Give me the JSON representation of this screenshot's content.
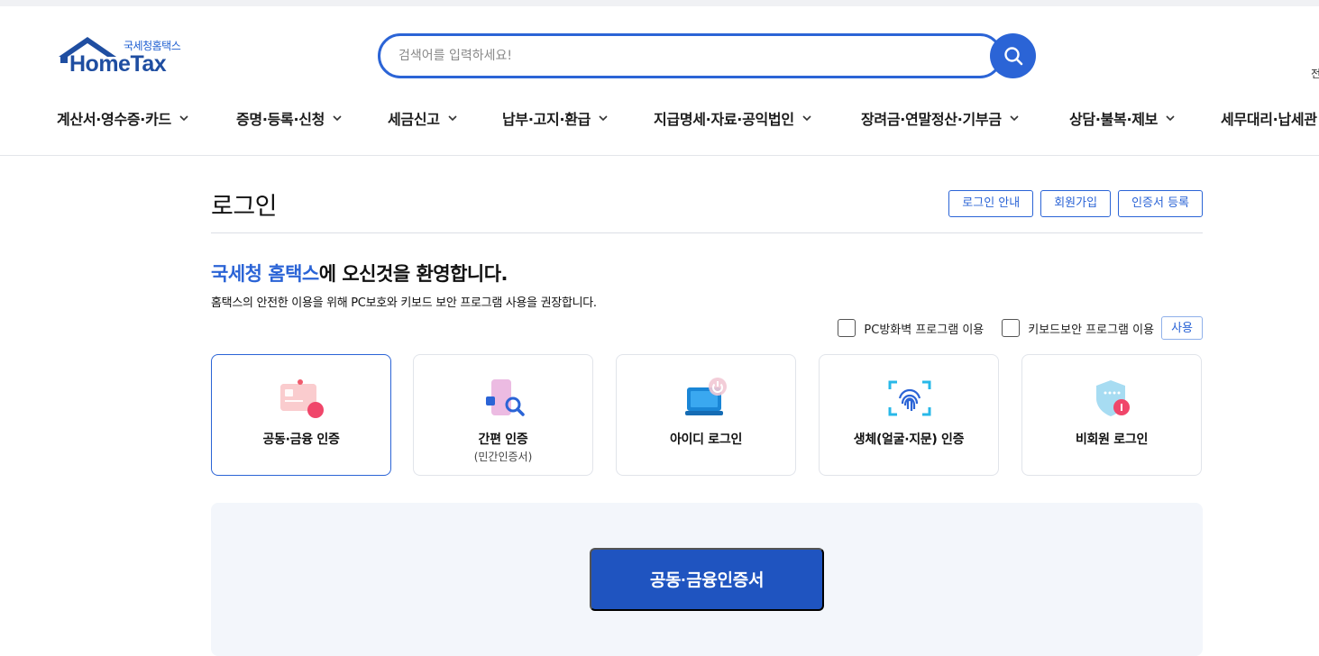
{
  "logo": {
    "sub": "국세청홈택스",
    "main": "HomeTax"
  },
  "search": {
    "placeholder": "검색어를 입력하세요!"
  },
  "header_edge_text": "전",
  "nav": [
    "계산서·영수증·카드",
    "증명·등록·신청",
    "세금신고",
    "납부·고지·환급",
    "지급명세·자료·공익법인",
    "장려금·연말정산·기부금",
    "상담·불복·제보",
    "세무대리·납세관"
  ],
  "page": {
    "title": "로그인",
    "buttons": [
      "로그인 안내",
      "회원가입",
      "인증서 등록"
    ],
    "welcome_highlight": "국세청 홈택스",
    "welcome_rest": "에 오신것을 환영합니다.",
    "welcome_sub": "홈택스의 안전한 이용을 위해 PC보호와 키보드 보안 프로그램 사용을 권장합니다.",
    "option_firewall": "PC방화벽 프로그램 이용",
    "option_keyboard": "키보드보안 프로그램 이용",
    "use_button": "사용"
  },
  "login_methods": [
    {
      "label": "공동·금융 인증",
      "sub": "",
      "icon": "certificate-card-icon",
      "selected": true
    },
    {
      "label": "간편 인증",
      "sub": "(민간인증서)",
      "icon": "phone-search-icon",
      "selected": false
    },
    {
      "label": "아이디 로그인",
      "sub": "",
      "icon": "laptop-power-icon",
      "selected": false
    },
    {
      "label": "생체(얼굴·지문) 인증",
      "sub": "",
      "icon": "fingerprint-icon",
      "selected": false
    },
    {
      "label": "비회원 로그인",
      "sub": "",
      "icon": "shield-lock-icon",
      "selected": false
    }
  ],
  "main_action": "공동·금융인증서",
  "colors": {
    "accent": "#2b64d6",
    "brand_dark": "#1f4ea1",
    "action_button": "#1f54c0",
    "panel_bg": "#f3f6fb"
  }
}
